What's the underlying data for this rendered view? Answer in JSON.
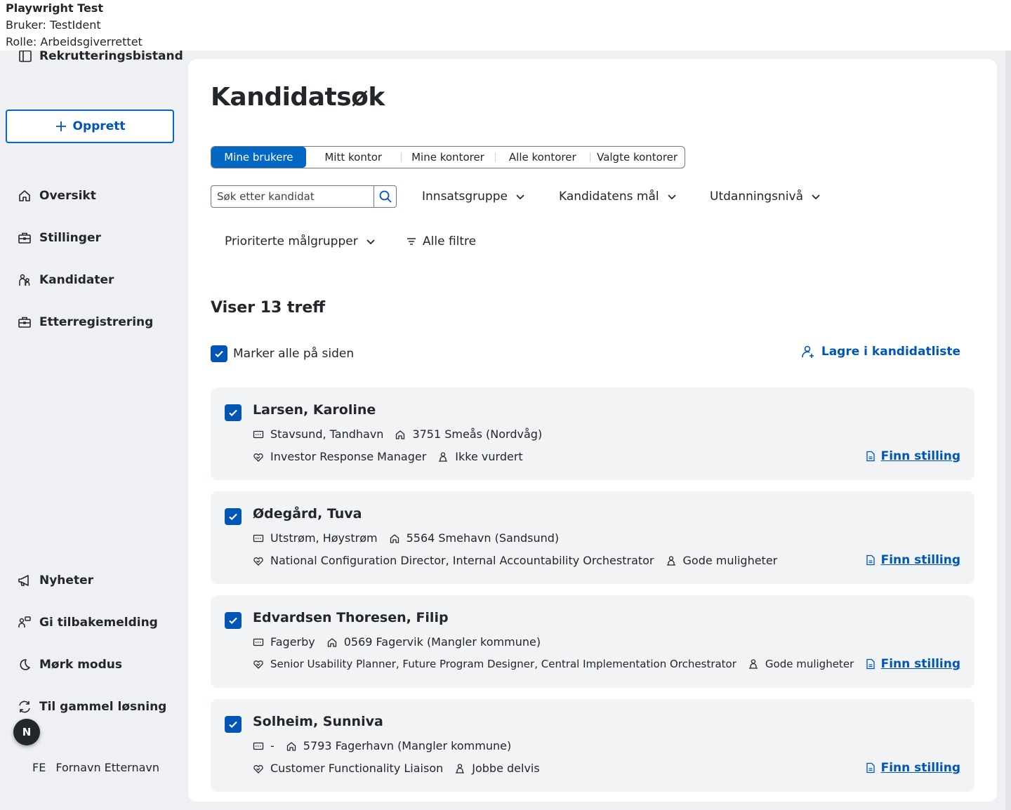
{
  "topinfo": {
    "title": "Playwright Test",
    "user": "Bruker: TestIdent",
    "role": "Rolle: Arbeidsgiverrettet"
  },
  "sidebar": {
    "brand": "Rekrutteringsbistand",
    "create": "Opprett",
    "nav": [
      {
        "label": "Oversikt",
        "icon": "house-icon"
      },
      {
        "label": "Stillinger",
        "icon": "briefcase-icon"
      },
      {
        "label": "Kandidater",
        "icon": "persons-icon"
      },
      {
        "label": "Etterregistrering",
        "icon": "briefcase-icon"
      }
    ],
    "bottom": [
      {
        "label": "Nyheter",
        "icon": "megaphone-icon"
      },
      {
        "label": "Gi tilbakemelding",
        "icon": "feedback-icon"
      },
      {
        "label": "Mørk modus",
        "icon": "moon-icon"
      },
      {
        "label": "Til gammel løsning",
        "icon": "arrows-circle-icon"
      }
    ],
    "avatar_letter": "N",
    "user_initials": "FE",
    "user_name": "Fornavn Etternavn"
  },
  "main": {
    "title": "Kandidatsøk",
    "tabs": [
      "Mine brukere",
      "Mitt kontor",
      "Mine kontorer",
      "Alle kontorer",
      "Valgte kontorer"
    ],
    "active_tab": 0,
    "search_placeholder": "Søk etter kandidat",
    "filters": [
      "Innsatsgruppe",
      "Kandidatens mål",
      "Utdanningsnivå",
      "Prioriterte målgrupper"
    ],
    "all_filters": "Alle filtre",
    "hits": "Viser 13 treff",
    "mark_all": "Marker alle på siden",
    "save_list": "Lagre i kandidatliste",
    "find_position": "Finn stilling"
  },
  "candidates": [
    {
      "name": "Larsen, Karoline",
      "place": "Stavsund, Tandhavn",
      "address": "3751 Smeås (Nordvåg)",
      "goal": "Investor Response Manager",
      "status": "Ikke vurdert",
      "checked": true
    },
    {
      "name": "Ødegård, Tuva",
      "place": "Utstrøm, Høystrøm",
      "address": "5564 Smehavn (Sandsund)",
      "goal": "National Configuration Director, Internal Accountability Orchestrator",
      "status": "Gode muligheter",
      "checked": true
    },
    {
      "name": "Edvardsen Thoresen, Filip",
      "place": "Fagerby",
      "address": "0569 Fagervik (Mangler kommune)",
      "goal": "Senior Usability Planner, Future Program Designer, Central Implementation Orchestrator",
      "status": "Gode muligheter",
      "checked": true
    },
    {
      "name": "Solheim, Sunniva",
      "place": "-",
      "address": "5793 Fagerhavn (Mangler kommune)",
      "goal": "Customer Functionality Liaison",
      "status": "Jobbe delvis",
      "checked": true
    }
  ],
  "colors": {
    "accent": "#0067c5",
    "link": "#0056b4",
    "background": "#eef0f3",
    "card": "#f1f3f5"
  }
}
